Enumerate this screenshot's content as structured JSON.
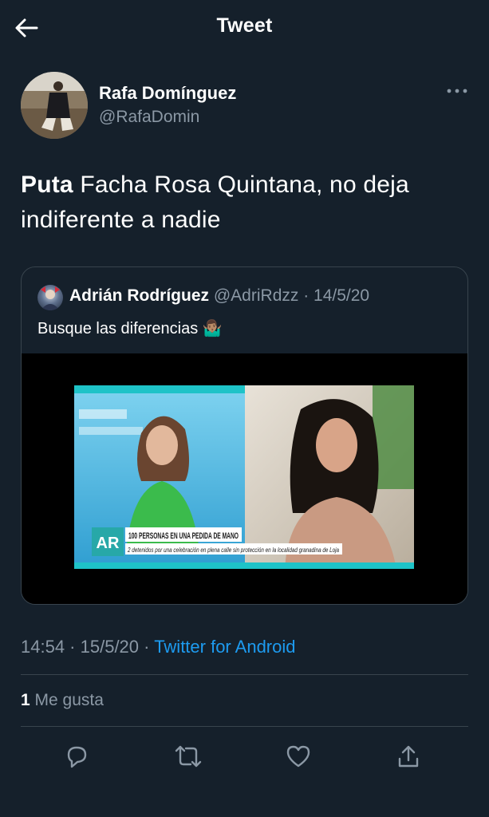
{
  "header": {
    "title": "Tweet",
    "back_icon": "arrow-left-icon"
  },
  "author": {
    "name": "Rafa Domínguez",
    "handle": "@RafaDomin",
    "more_icon": "more-horizontal-icon"
  },
  "tweet": {
    "bold": "Puta",
    "text": " Facha Rosa Quintana, no deja indiferente a nadie"
  },
  "quoted_tweet": {
    "name": "Adrián Rodríguez",
    "handle": "@AdriRdzz",
    "separator": " · ",
    "date": "14/5/20",
    "text": "Busque las diferencias",
    "emoji": "🤷🏽‍♂️",
    "media": {
      "channel_logo": "AR",
      "headline": "100 PERSONAS EN UNA PEDIDA DE MANO",
      "subheadline": "2 detenidos por una celebración en plena calle sin protección en la localidad granadina de Loja"
    }
  },
  "meta": {
    "time": "14:54",
    "sep1": " · ",
    "date": "15/5/20",
    "sep2": " · ",
    "source": "Twitter for Android"
  },
  "stats": {
    "likes_count": "1",
    "likes_label": " Me gusta"
  },
  "actions": [
    "reply-icon",
    "retweet-icon",
    "like-icon",
    "share-icon"
  ],
  "colors": {
    "background": "#15202b",
    "border": "#38444d",
    "secondary_text": "#8b98a5",
    "accent": "#1d9bf0"
  }
}
